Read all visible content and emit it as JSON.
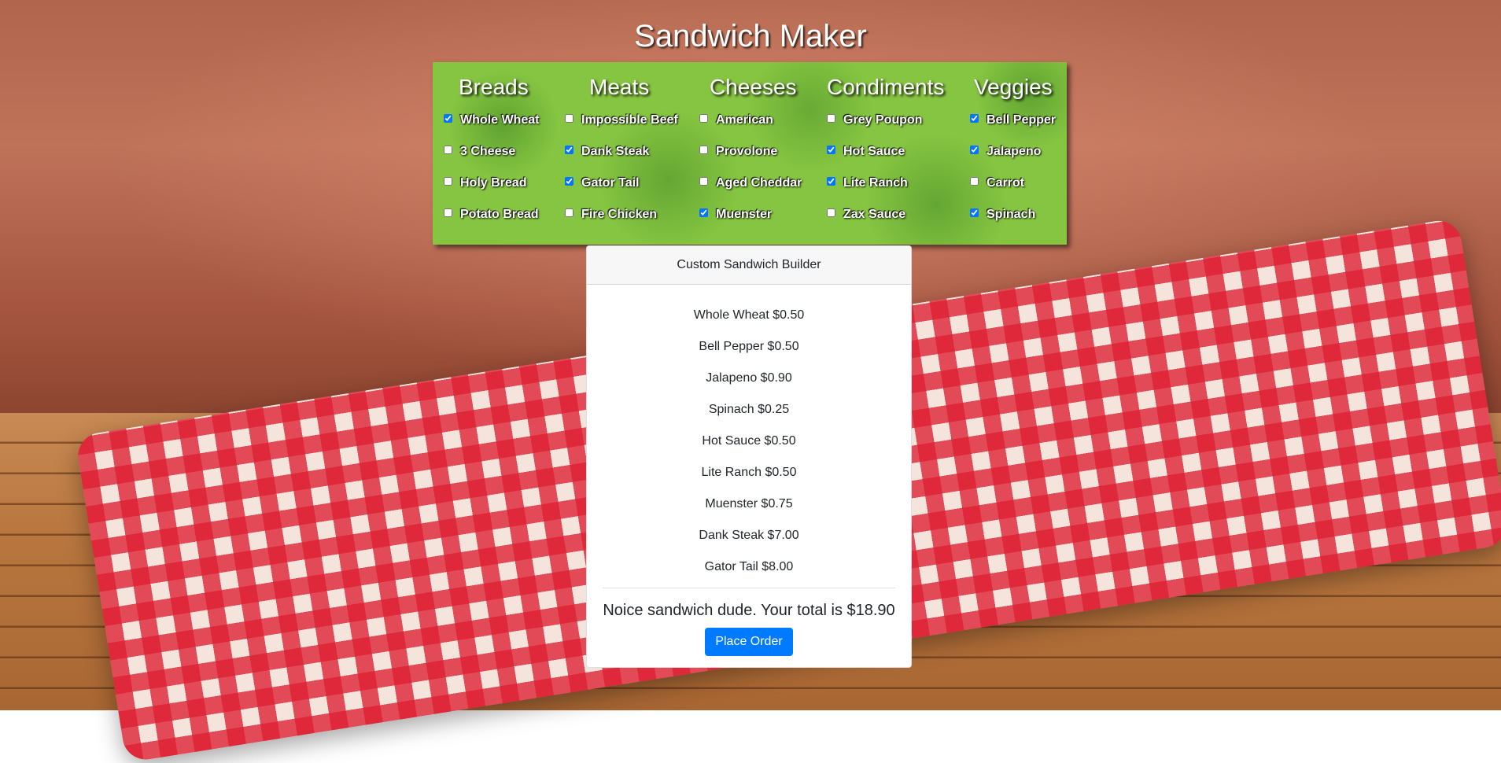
{
  "page": {
    "title": "Sandwich Maker"
  },
  "categories": [
    {
      "name": "Breads",
      "options": [
        {
          "label": "Whole Wheat",
          "checked": true
        },
        {
          "label": "3 Cheese",
          "checked": false
        },
        {
          "label": "Holy Bread",
          "checked": false
        },
        {
          "label": "Potato Bread",
          "checked": false
        }
      ]
    },
    {
      "name": "Meats",
      "options": [
        {
          "label": "Impossible Beef",
          "checked": false
        },
        {
          "label": "Dank Steak",
          "checked": true
        },
        {
          "label": "Gator Tail",
          "checked": true
        },
        {
          "label": "Fire Chicken",
          "checked": false
        }
      ]
    },
    {
      "name": "Cheeses",
      "options": [
        {
          "label": "American",
          "checked": false
        },
        {
          "label": "Provolone",
          "checked": false
        },
        {
          "label": "Aged Cheddar",
          "checked": false
        },
        {
          "label": "Muenster",
          "checked": true
        }
      ]
    },
    {
      "name": "Condiments",
      "options": [
        {
          "label": "Grey Poupon",
          "checked": false
        },
        {
          "label": "Hot Sauce",
          "checked": true
        },
        {
          "label": "Lite Ranch",
          "checked": true
        },
        {
          "label": "Zax Sauce",
          "checked": false
        }
      ]
    },
    {
      "name": "Veggies",
      "options": [
        {
          "label": "Bell Pepper",
          "checked": true
        },
        {
          "label": "Jalapeno",
          "checked": true
        },
        {
          "label": "Carrot",
          "checked": false
        },
        {
          "label": "Spinach",
          "checked": true
        }
      ]
    }
  ],
  "builder": {
    "header": "Custom Sandwich Builder",
    "items": [
      "Whole Wheat $0.50",
      "Bell Pepper $0.50",
      "Jalapeno $0.90",
      "Spinach $0.25",
      "Hot Sauce $0.50",
      "Lite Ranch $0.50",
      "Muenster $0.75",
      "Dank Steak $7.00",
      "Gator Tail $8.00"
    ],
    "total_text": "Noice sandwich dude. Your total is $18.90",
    "order_button": "Place Order"
  },
  "colors": {
    "panel": "#86c541",
    "button": "#007bff"
  }
}
